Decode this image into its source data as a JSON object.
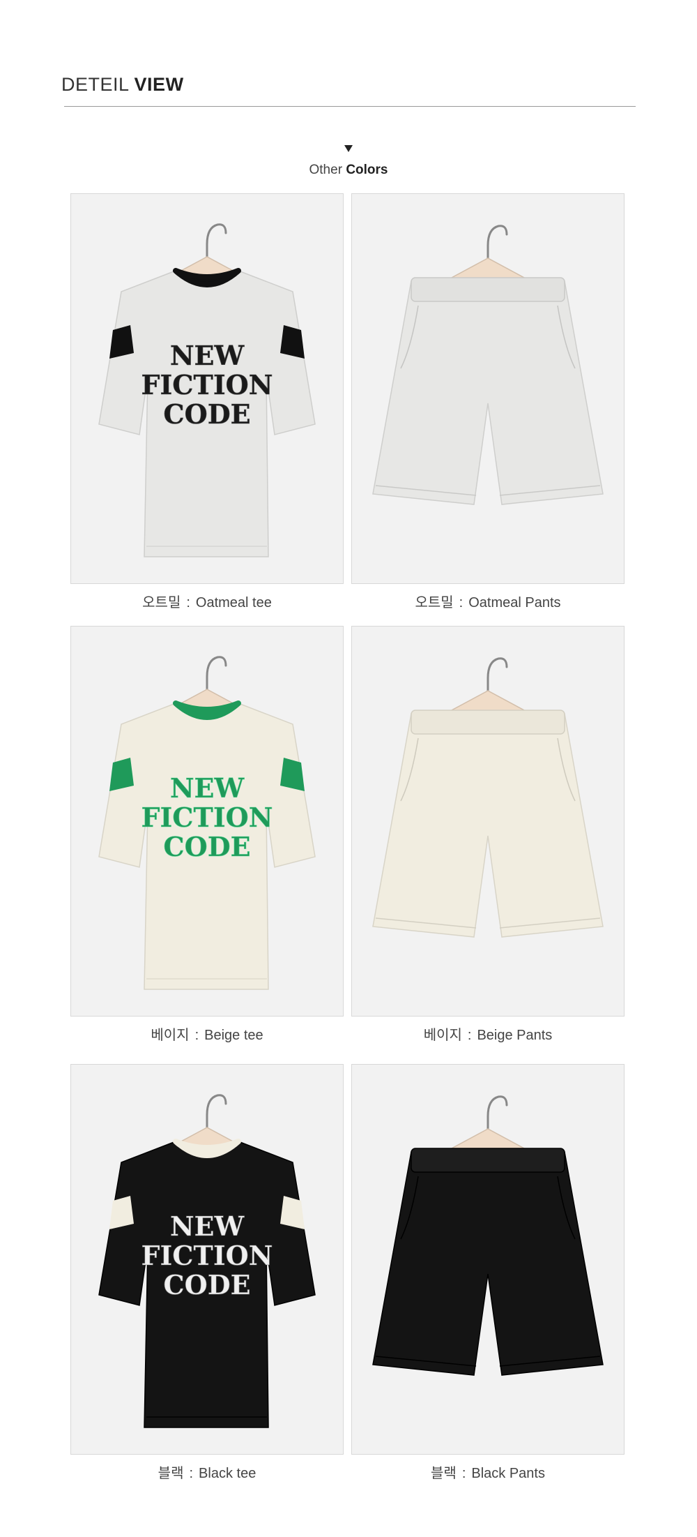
{
  "header": {
    "title_light": "DETEIL",
    "title_bold": "VIEW"
  },
  "subhead": {
    "light": "Other",
    "bold": "Colors"
  },
  "products": [
    {
      "korean": "오트밀",
      "english": "Oatmeal tee",
      "kind": "tee",
      "body_color": "#e7e7e5",
      "accent_color": "#111111",
      "print_color": "#1a1a1a",
      "print_lines": [
        "NEW",
        "FICTION",
        "CODE"
      ]
    },
    {
      "korean": "오트밀",
      "english": "Oatmeal Pants",
      "kind": "pants",
      "body_color": "#e7e7e5"
    },
    {
      "korean": "베이지",
      "english": "Beige tee",
      "kind": "tee",
      "body_color": "#f1ede0",
      "accent_color": "#1f9a5a",
      "print_color": "#1f9a5a",
      "print_lines": [
        "NEW",
        "FICTION",
        "CODE"
      ]
    },
    {
      "korean": "베이지",
      "english": "Beige Pants",
      "kind": "pants",
      "body_color": "#f1ede0"
    },
    {
      "korean": "블랙",
      "english": "Black tee",
      "kind": "tee",
      "body_color": "#141414",
      "accent_color": "#f1ede0",
      "print_color": "#f0f0f0",
      "print_lines": [
        "NEW",
        "FICTION",
        "CODE"
      ]
    },
    {
      "korean": "블랙",
      "english": "Black Pants",
      "kind": "pants",
      "body_color": "#141414"
    }
  ],
  "caption_separator": ":",
  "colors": {
    "photo_background": "#f2f2f2",
    "hanger": "#f0dcc8",
    "hook": "#888888"
  }
}
